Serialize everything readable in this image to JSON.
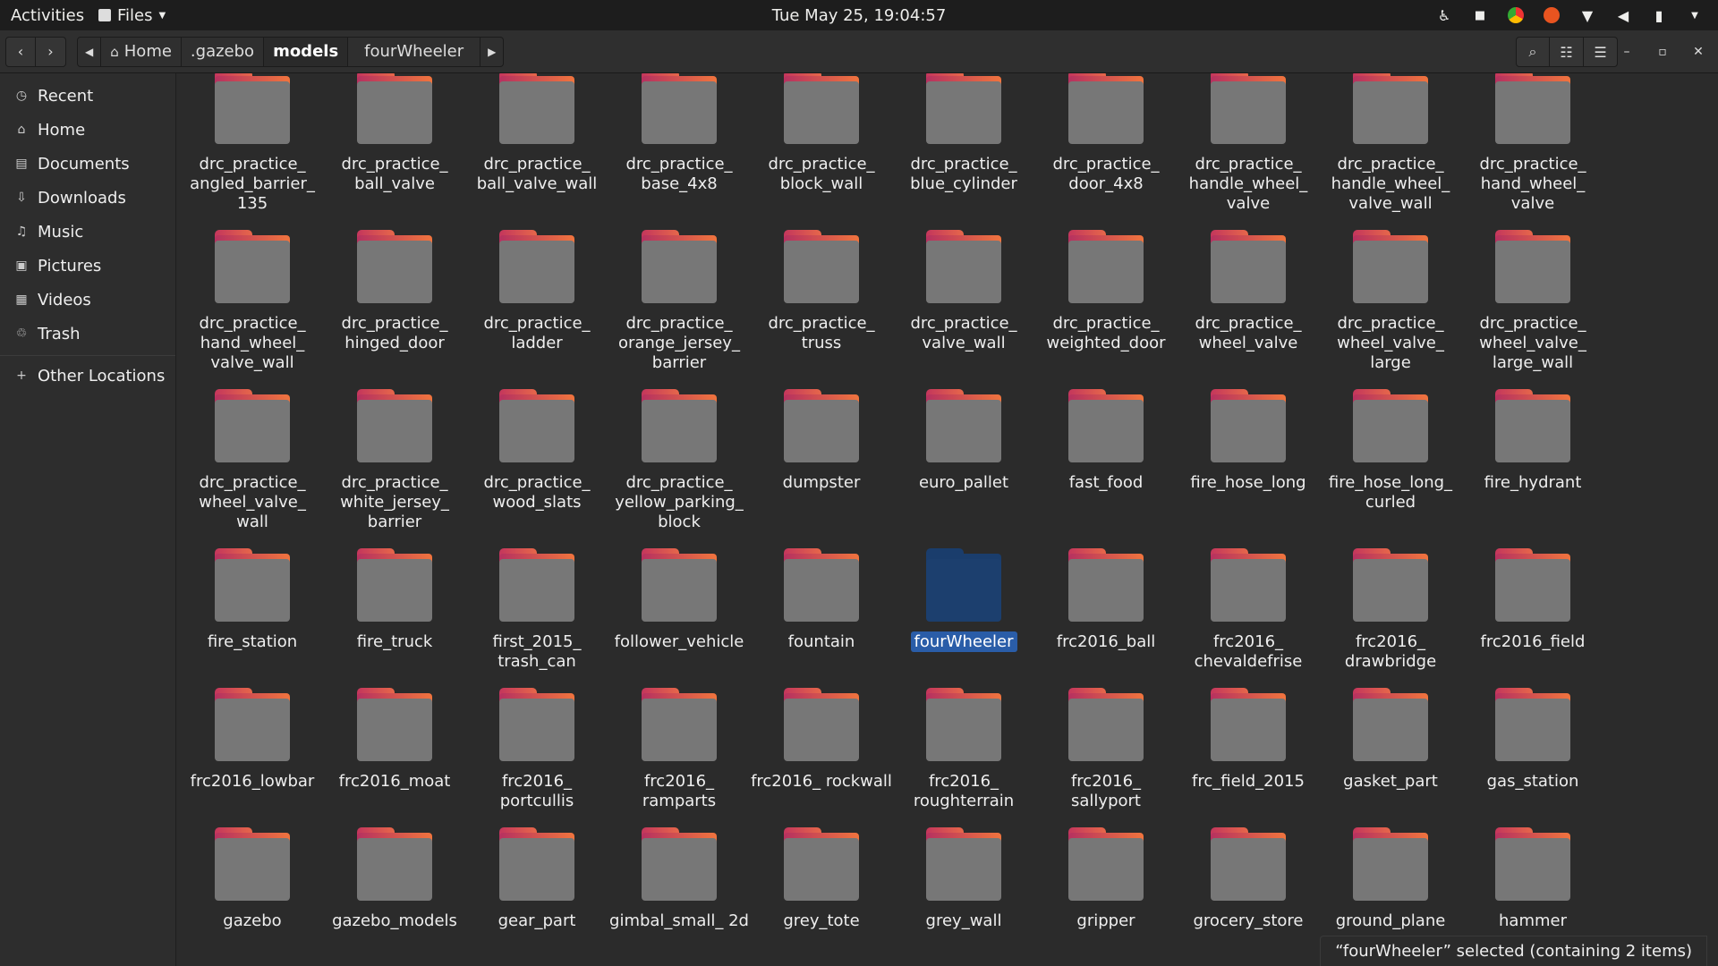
{
  "topbar": {
    "activities": "Activities",
    "app_name": "Files",
    "clock": "Tue May 25, 19:04:57"
  },
  "toolbar": {
    "breadcrumbs": [
      "Home",
      ".gazebo",
      "models",
      "fourWheeler"
    ]
  },
  "sidebar": {
    "items": [
      {
        "label": "Recent",
        "icon": "clock-icon"
      },
      {
        "label": "Home",
        "icon": "home-icon"
      },
      {
        "label": "Documents",
        "icon": "document-icon"
      },
      {
        "label": "Downloads",
        "icon": "download-icon"
      },
      {
        "label": "Music",
        "icon": "music-icon"
      },
      {
        "label": "Pictures",
        "icon": "picture-icon"
      },
      {
        "label": "Videos",
        "icon": "video-icon"
      },
      {
        "label": "Trash",
        "icon": "trash-icon"
      }
    ],
    "other_locations": "Other Locations"
  },
  "folders": [
    [
      "drc_practice_ angled_barrier_ 135",
      "drc_practice_ ball_valve",
      "drc_practice_ ball_valve_wall",
      "drc_practice_ base_4x8",
      "drc_practice_ block_wall",
      "drc_practice_ blue_cylinder",
      "drc_practice_ door_4x8",
      "drc_practice_ handle_wheel_ valve",
      "drc_practice_ handle_wheel_ valve_wall",
      "drc_practice_ hand_wheel_ valve"
    ],
    [
      "drc_practice_ hand_wheel_ valve_wall",
      "drc_practice_ hinged_door",
      "drc_practice_ ladder",
      "drc_practice_ orange_jersey_ barrier",
      "drc_practice_ truss",
      "drc_practice_ valve_wall",
      "drc_practice_ weighted_door",
      "drc_practice_ wheel_valve",
      "drc_practice_ wheel_valve_ large",
      "drc_practice_ wheel_valve_ large_wall"
    ],
    [
      "drc_practice_ wheel_valve_ wall",
      "drc_practice_ white_jersey_ barrier",
      "drc_practice_ wood_slats",
      "drc_practice_ yellow_parking_ block",
      "dumpster",
      "euro_pallet",
      "fast_food",
      "fire_hose_long",
      "fire_hose_long_ curled",
      "fire_hydrant"
    ],
    [
      "fire_station",
      "fire_truck",
      "first_2015_ trash_can",
      "follower_vehicle",
      "fountain",
      "fourWheeler",
      "frc2016_ball",
      "frc2016_ chevaldefrise",
      "frc2016_ drawbridge",
      "frc2016_field"
    ],
    [
      "frc2016_lowbar",
      "frc2016_moat",
      "frc2016_ portcullis",
      "frc2016_ ramparts",
      "frc2016_ rockwall",
      "frc2016_ roughterrain",
      "frc2016_ sallyport",
      "frc_field_2015",
      "gasket_part",
      "gas_station"
    ],
    [
      "gazebo",
      "gazebo_models",
      "gear_part",
      "gimbal_small_ 2d",
      "grey_tote",
      "grey_wall",
      "gripper",
      "grocery_store",
      "ground_plane",
      "hammer"
    ]
  ],
  "selected_folder": "fourWheeler",
  "status": "“fourWheeler” selected (containing 2 items)"
}
